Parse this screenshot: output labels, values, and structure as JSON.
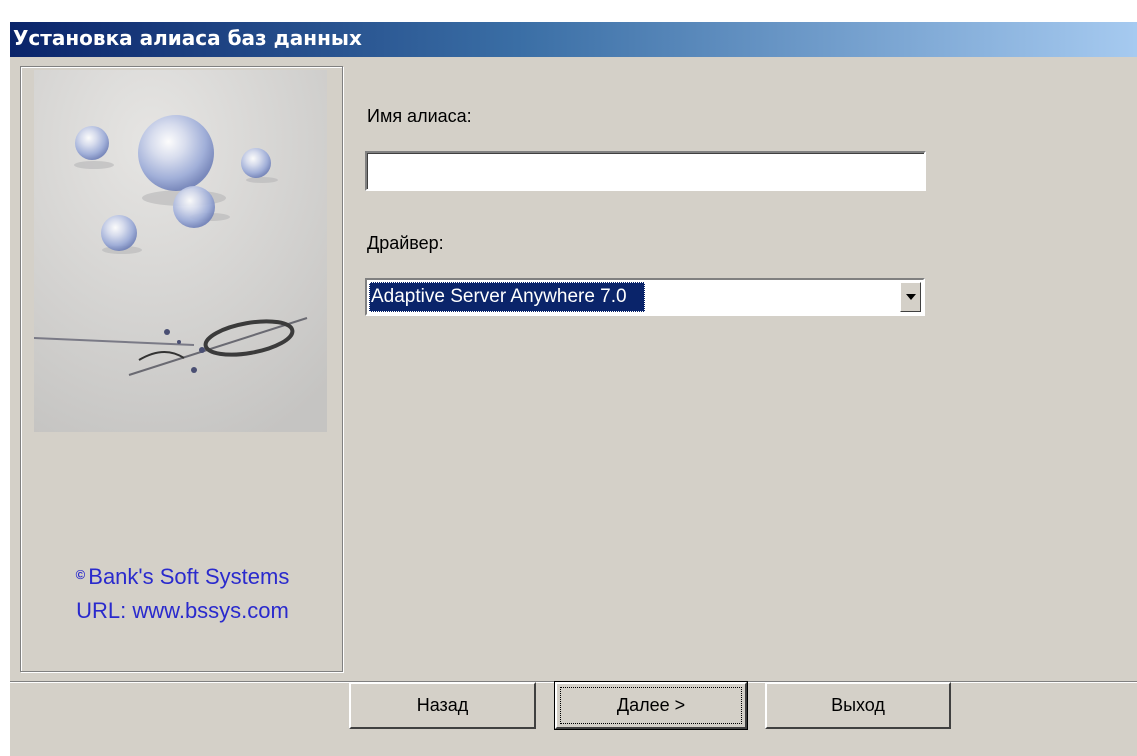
{
  "window": {
    "title": "Установка алиаса баз данных"
  },
  "side_panel": {
    "copyright_line": "Bank's Soft Systems",
    "copyright_symbol": "©",
    "url_line": "URL:  www.bssys.com"
  },
  "form": {
    "alias_label": "Имя алиаса:",
    "alias_value": "",
    "driver_label": "Драйвер:",
    "driver_value": "Adaptive Server Anywhere 7.0"
  },
  "buttons": {
    "back": "Назад",
    "next": "Далее >",
    "exit": "Выход"
  },
  "colors": {
    "title_gradient_start": "#0a246a",
    "title_gradient_end": "#a6caf0",
    "window_bg": "#d4d0c8",
    "copyright_text": "#2a2acd",
    "selection_bg": "#0a246a"
  },
  "icons": {
    "combo_dropdown": "chevron-down-icon"
  }
}
